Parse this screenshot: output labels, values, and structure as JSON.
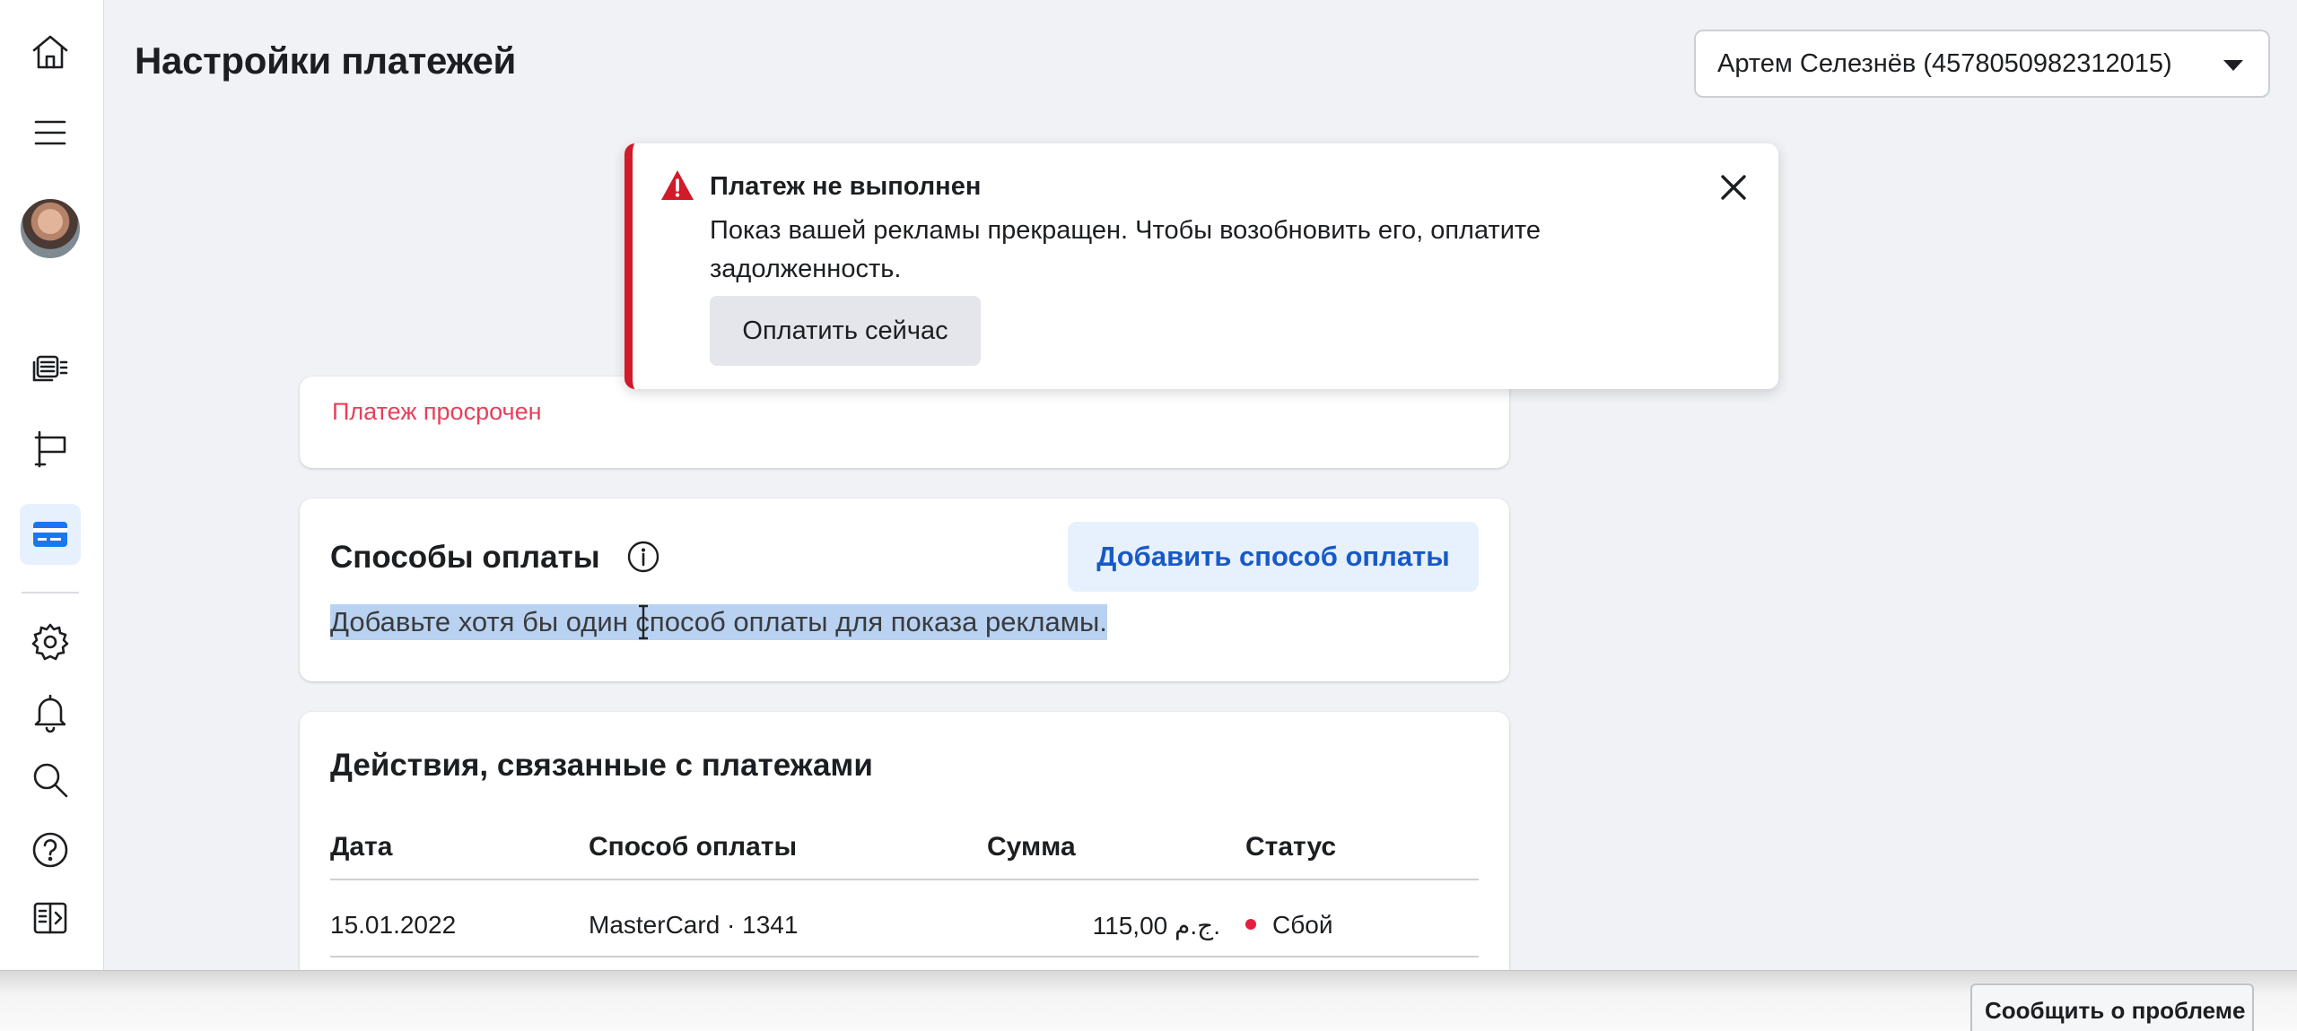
{
  "header": {
    "title": "Настройки платежей",
    "account_label": "Артем Селезнёв (4578050982312015)"
  },
  "nav": {
    "items": [
      "home",
      "menu",
      "profile",
      "campaigns",
      "pages",
      "billing",
      "settings",
      "notifications",
      "search",
      "help",
      "collapse"
    ]
  },
  "alert": {
    "title": "Платеж не выполнен",
    "body": "Показ вашей рекламы прекращен. Чтобы возобновить его, оплатите задолженность.",
    "action_label": "Оплатить сейчас"
  },
  "overdue": {
    "text": "Платеж просрочен"
  },
  "payment_methods": {
    "title": "Способы оплаты",
    "add_label": "Добавить способ оплаты",
    "hint": "Добавьте хотя бы один способ оплаты для показа рекламы."
  },
  "activity": {
    "title": "Действия, связанные с платежами",
    "columns": [
      "Дата",
      "Способ оплаты",
      "Сумма",
      "Статус"
    ],
    "rows": [
      {
        "date": "15.01.2022",
        "method": "MasterCard · 1341",
        "amount": "115,00 ج.م.",
        "status": "Сбой"
      }
    ]
  },
  "footer": {
    "report_label": "Сообщить о проблеме"
  },
  "colors": {
    "accent": "#1877f2",
    "error": "#e41e3f",
    "add_button_bg": "#e7f0fd"
  }
}
